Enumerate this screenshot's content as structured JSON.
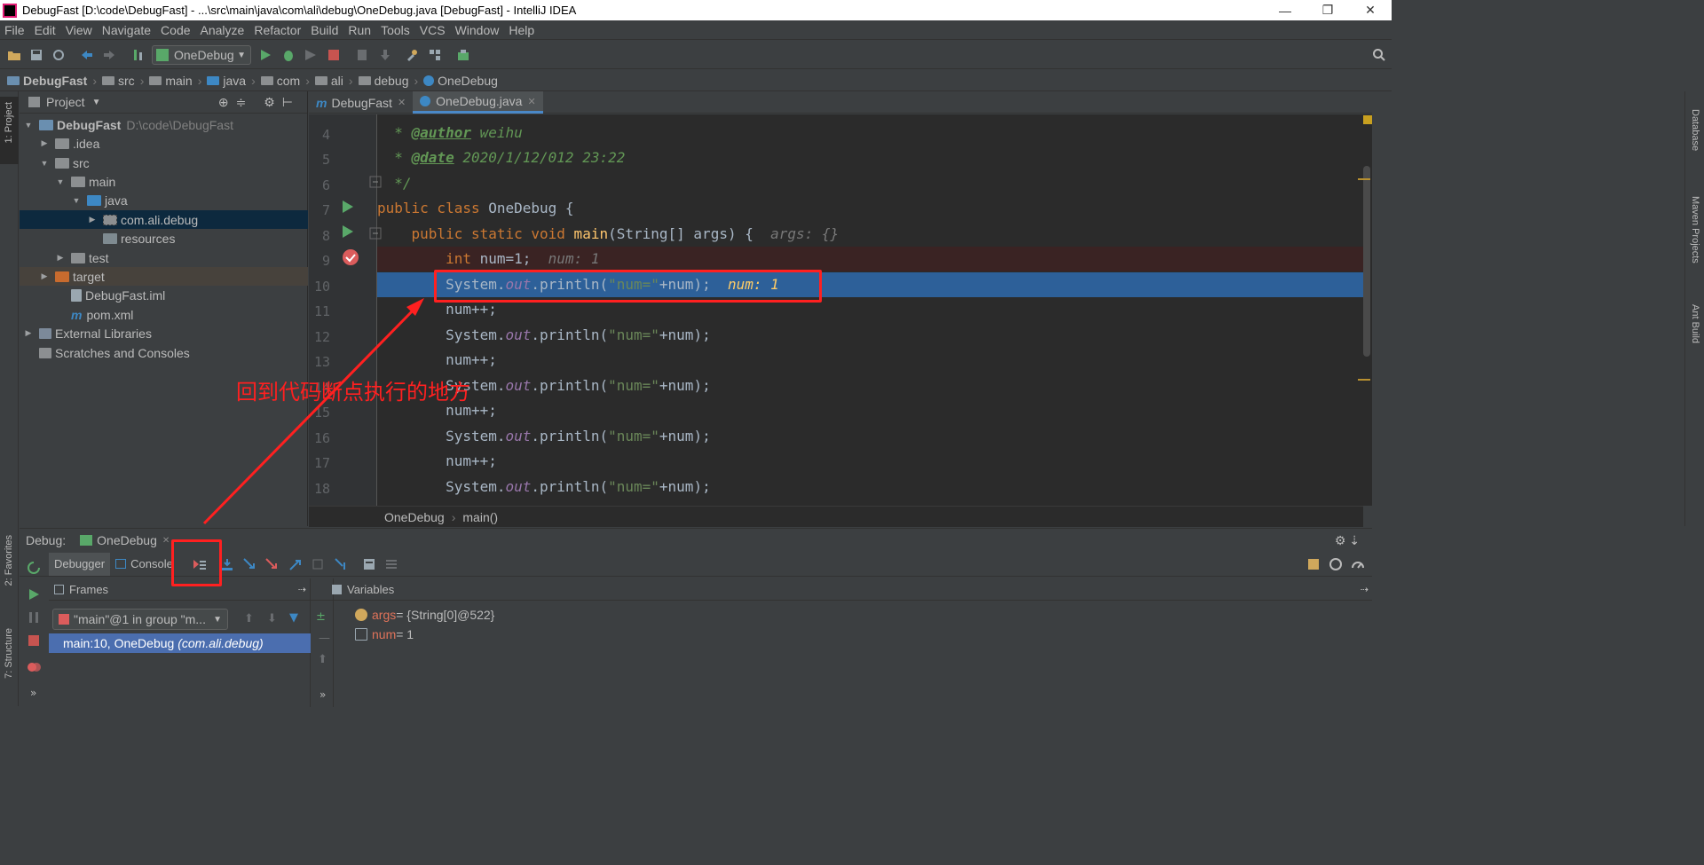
{
  "window": {
    "title": "DebugFast [D:\\code\\DebugFast] - ...\\src\\main\\java\\com\\ali\\debug\\OneDebug.java [DebugFast] - IntelliJ IDEA",
    "minimize": "—",
    "restore": "❐",
    "close": "✕"
  },
  "menu": [
    "File",
    "Edit",
    "View",
    "Navigate",
    "Code",
    "Analyze",
    "Refactor",
    "Build",
    "Run",
    "Tools",
    "VCS",
    "Window",
    "Help"
  ],
  "toolbar": {
    "run_config": "OneDebug"
  },
  "breadcrumb": [
    "DebugFast",
    "src",
    "main",
    "java",
    "com",
    "ali",
    "debug",
    "OneDebug"
  ],
  "left_stripe": {
    "project": "1: Project",
    "favorites": "2: Favorites",
    "structure": "7: Structure"
  },
  "right_stripe": {
    "database": "Database",
    "maven": "Maven Projects",
    "ant": "Ant Build"
  },
  "project_panel": {
    "title": "Project",
    "tree": [
      {
        "label": "DebugFast",
        "hint": "D:\\code\\DebugFast"
      },
      {
        "label": ".idea"
      },
      {
        "label": "src"
      },
      {
        "label": "main"
      },
      {
        "label": "java"
      },
      {
        "label": "com.ali.debug"
      },
      {
        "label": "resources"
      },
      {
        "label": "test"
      },
      {
        "label": "target"
      },
      {
        "label": "DebugFast.iml"
      },
      {
        "label": "pom.xml"
      },
      {
        "label": "External Libraries"
      },
      {
        "label": "Scratches and Consoles"
      }
    ]
  },
  "editor": {
    "tabs": [
      {
        "label": "DebugFast",
        "close": "✕"
      },
      {
        "label": "OneDebug.java",
        "close": "✕"
      }
    ],
    "lines": [
      {
        "n": "4",
        "tag": "@author",
        "text": " weihu"
      },
      {
        "n": "5",
        "tag": "@date",
        "text": " 2020/1/12/012 23:22"
      },
      {
        "n": "6",
        "text": "*/"
      },
      {
        "n": "7",
        "kw": "public class",
        "text": " OneDebug {"
      },
      {
        "n": "8",
        "kw": "public static void",
        "method": " main",
        "text": "(String[] args) {",
        "hint": "args: {}"
      },
      {
        "n": "9",
        "kw": "int",
        "text": " num=1;",
        "hint": "num: 1"
      },
      {
        "n": "10",
        "pre": "System.",
        "field": "out",
        "call": ".println(",
        "str": "\"num=\"",
        "post": "+num);",
        "hint": "num: 1"
      },
      {
        "n": "11",
        "text": "num++;"
      },
      {
        "n": "12",
        "pre": "System.",
        "field": "out",
        "call": ".println(",
        "str": "\"num=\"",
        "post": "+num);"
      },
      {
        "n": "13",
        "text": "num++;"
      },
      {
        "n": "14",
        "pre": "System.",
        "field": "out",
        "call": ".println(",
        "str": "\"num=\"",
        "post": "+num);"
      },
      {
        "n": "15",
        "text": "num++;"
      },
      {
        "n": "16",
        "pre": "System.",
        "field": "out",
        "call": ".println(",
        "str": "\"num=\"",
        "post": "+num);"
      },
      {
        "n": "17",
        "text": "num++;"
      },
      {
        "n": "18",
        "pre": "System.",
        "field": "out",
        "call": ".println(",
        "str": "\"num=\"",
        "post": "+num);"
      }
    ],
    "comment_prefix": "* ",
    "crumbs": [
      "OneDebug",
      "main()"
    ]
  },
  "debug": {
    "label": "Debug:",
    "session": "OneDebug",
    "session_close": "✕",
    "tabs": [
      "Debugger",
      "Console"
    ],
    "frames_title": "Frames",
    "variables_title": "Variables",
    "thread": "\"main\"@1 in group \"m...",
    "frame": "main:10, OneDebug",
    "frame_pkg": "(com.ali.debug)",
    "variables": [
      {
        "name": "args",
        "value": " = {String[0]@522}"
      },
      {
        "name": "num",
        "value": " = 1"
      }
    ]
  },
  "annotation": {
    "text": "回到代码断点执行的地方",
    "color": "#ff2020"
  }
}
